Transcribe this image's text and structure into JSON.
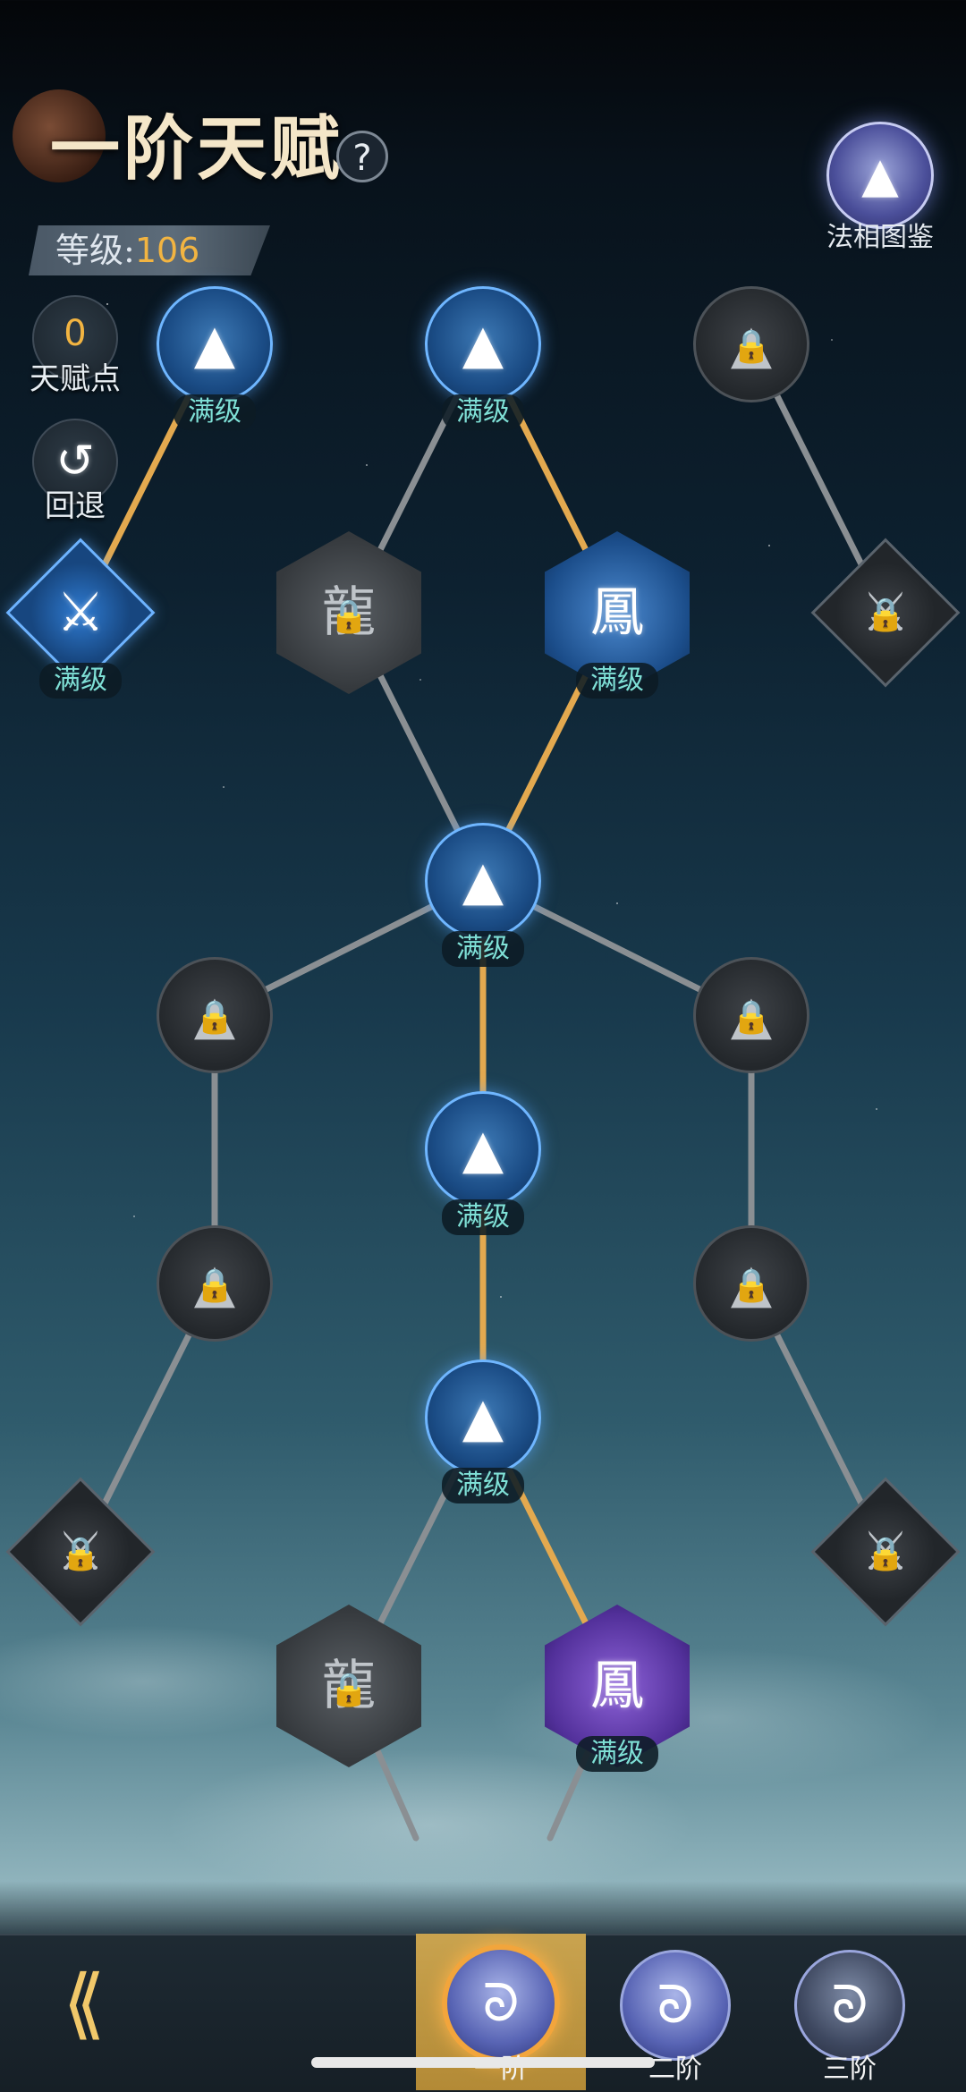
{
  "header": {
    "title": "一阶天赋",
    "help_icon": "?",
    "level_label": "等级:",
    "level_value": "106",
    "atlas_label": "法相图鉴"
  },
  "sidebar": {
    "talent_points_value": "0",
    "talent_points_label": "天赋点",
    "undo_label": "回退",
    "undo_icon": "↺"
  },
  "nodes": {
    "n1": {
      "badge": "满级"
    },
    "n2": {
      "badge": "满级"
    },
    "n4": {
      "badge": "满级"
    },
    "n6": {
      "badge": "满级"
    },
    "n7": {
      "badge": "满级"
    },
    "n10": {
      "badge": "满级"
    },
    "n11": {
      "badge": "满级"
    },
    "n17": {
      "badge": "满级"
    }
  },
  "icons": {
    "stupa": "▲",
    "sword": "⚔",
    "dragon": "龍",
    "phoenix": "鳳",
    "lock": "🔒",
    "back": "⟪"
  },
  "tabs": [
    {
      "label": "一阶",
      "glyph": "ᘐ"
    },
    {
      "label": "二阶",
      "glyph": "ᘐ"
    },
    {
      "label": "三阶",
      "glyph": "ᘐ"
    }
  ],
  "colors": {
    "active_path": "#e3a94f",
    "inactive_path": "#8a8f93",
    "level_number": "#f2b441",
    "maxed_badge_text": "#7fe0d6"
  }
}
